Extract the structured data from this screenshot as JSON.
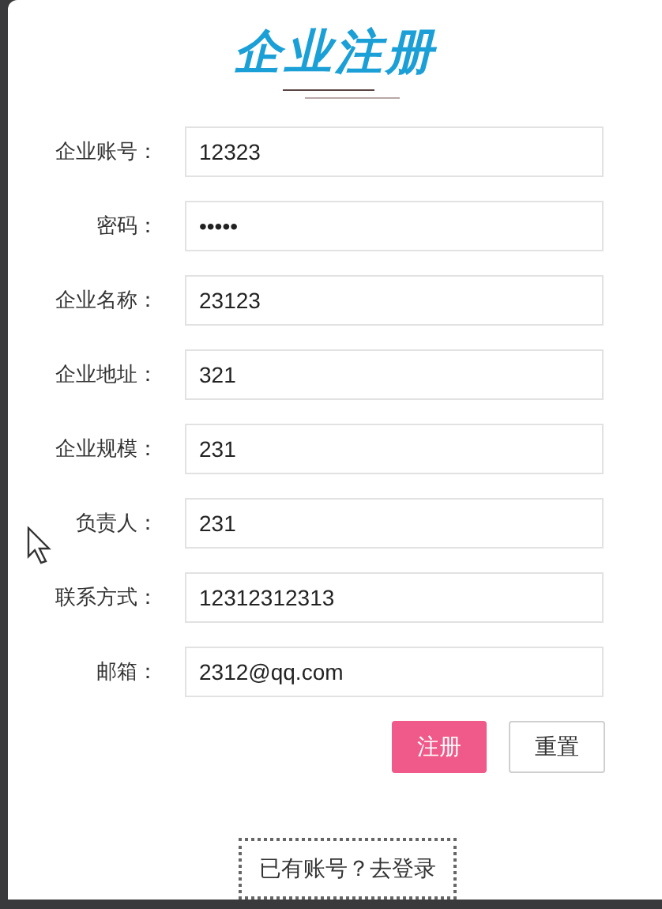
{
  "title": "企业注册",
  "fields": [
    {
      "label": "企业账号：",
      "value": "12323"
    },
    {
      "label": "密码：",
      "value": "•••••"
    },
    {
      "label": "企业名称：",
      "value": "23123"
    },
    {
      "label": "企业地址：",
      "value": "321"
    },
    {
      "label": "企业规模：",
      "value": "231"
    },
    {
      "label": "负责人：",
      "value": "231"
    },
    {
      "label": "联系方式：",
      "value": "12312312313"
    },
    {
      "label": "邮箱：",
      "value": "2312@qq.com"
    }
  ],
  "buttons": [
    {
      "label": "注册",
      "kind": "primary"
    },
    {
      "label": "重置",
      "kind": "plain"
    }
  ],
  "login_link": "已有账号？去登录"
}
